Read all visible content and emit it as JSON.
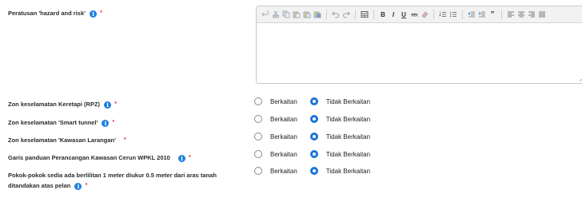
{
  "fields": [
    {
      "label": "Peratusan 'hazard and risk'",
      "info": true,
      "required": true
    },
    {
      "label": "Zon keselamatan Keretapi (RPZ)",
      "info": true,
      "required": true,
      "selected": 1
    },
    {
      "label": "Zon keselamatan 'Smart tunnel'",
      "info": true,
      "required": true,
      "selected": 1
    },
    {
      "label": "Zon keselamatan 'Kawasan Larangan'",
      "info": false,
      "required": true,
      "selected": 1
    },
    {
      "label": "Garis panduan Perancangan Kawasan Cerun WPKL 2010",
      "info": true,
      "required": true,
      "selected": 1
    },
    {
      "label_line1": "Pokok-pokok sedia ada berlilitan 1 meter diukur 0.5 meter dari aras tanah",
      "label_line2": "ditandakan atas pelan",
      "info": true,
      "required": true,
      "selected": 1
    }
  ],
  "options": [
    "Berkaitan",
    "Tidak Berkaitan"
  ],
  "info_glyph": "i",
  "required_mark": "*",
  "toolbar_icons": [
    "undo-icon-faded",
    "cut-icon",
    "copy-icon",
    "paste-icon",
    "paste-text-icon",
    "paste-word-icon",
    "undo-icon",
    "redo-icon",
    "table-icon",
    "bold-icon",
    "italic-icon",
    "underline-icon",
    "strikethrough-icon",
    "eraser-icon",
    "ordered-list-icon",
    "unordered-list-icon",
    "outdent-icon",
    "indent-icon",
    "blockquote-icon",
    "align-left-icon",
    "align-center-icon",
    "align-right-icon",
    "justify-icon"
  ],
  "toolbar_text": {
    "bold": "B",
    "italic": "I",
    "underline": "U"
  },
  "colors": {
    "accent": "#1b74d8",
    "required": "#e0302a",
    "info": "#1f7fe0"
  }
}
